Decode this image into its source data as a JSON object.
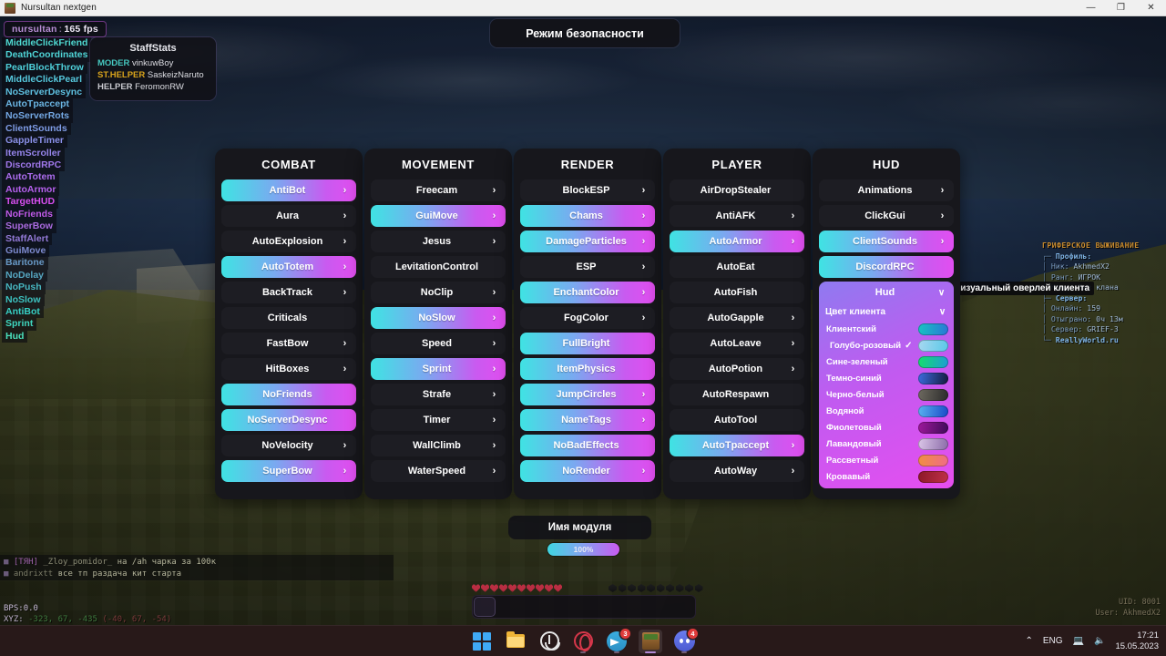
{
  "window": {
    "title": "Nursultan nextgen",
    "icon": "minecraft-block-icon",
    "minimize": "—",
    "maximize": "❐",
    "close": "✕"
  },
  "hud": {
    "watermark": {
      "name": "nursultan",
      "separator": ":",
      "fps": "165 fps"
    },
    "safe_mode_banner": "Режим безопасности",
    "module_name_popup": "Имя модуля",
    "module_progress": "100%",
    "tooltip": "Визуальный оверлей клиента",
    "uid": "UID: 8001",
    "user": "User: AkhmedX2",
    "active_modules": [
      {
        "label": "MiddleClickFriend",
        "color": "#4fd8d0"
      },
      {
        "label": "DeathCoordinates",
        "color": "#4fd4d6"
      },
      {
        "label": "PearlBlockThrow",
        "color": "#4fd0da"
      },
      {
        "label": "MiddleClickPearl",
        "color": "#56c8dd"
      },
      {
        "label": "NoServerDesync",
        "color": "#5ec0e0"
      },
      {
        "label": "AutoTpaccept",
        "color": "#6ab4e2"
      },
      {
        "label": "NoServerRots",
        "color": "#74a8e4"
      },
      {
        "label": "ClientSounds",
        "color": "#7f9ce6"
      },
      {
        "label": "GappleTimer",
        "color": "#8a90e8"
      },
      {
        "label": "ItemScroller",
        "color": "#9584ea"
      },
      {
        "label": "DiscordRPC",
        "color": "#a078eb"
      },
      {
        "label": "AutoTotem",
        "color": "#ab6ced"
      },
      {
        "label": "AutoArmor",
        "color": "#b660ee"
      },
      {
        "label": "TargetHUD",
        "color": "#d84ff0"
      },
      {
        "label": "NoFriends",
        "color": "#c05ae8"
      },
      {
        "label": "SuperBow",
        "color": "#a96ade"
      },
      {
        "label": "StaffAlert",
        "color": "#9279d6"
      },
      {
        "label": "GuiMove",
        "color": "#7c89ce"
      },
      {
        "label": "Baritone",
        "color": "#6899c6"
      },
      {
        "label": "NoDelay",
        "color": "#56a7c2"
      },
      {
        "label": "NoPush",
        "color": "#47b6c0"
      },
      {
        "label": "NoSlow",
        "color": "#3dc2c0"
      },
      {
        "label": "AntiBot",
        "color": "#37d0c4"
      },
      {
        "label": "Sprint",
        "color": "#3fd8c0"
      },
      {
        "label": "Hud",
        "color": "#4ae0bc"
      }
    ],
    "staff_stats": {
      "title": "StaffStats",
      "rows": [
        {
          "rank": "MODER",
          "rank_color": "#46c8c0",
          "nick": "vinkuwBoy"
        },
        {
          "rank": "ST.HELPER",
          "rank_color": "#d8a31c",
          "nick": "SaskeizNaruto"
        },
        {
          "rank": "HELPER",
          "rank_color": "#c9c9cf",
          "nick": "FeromonRW"
        }
      ]
    },
    "server_info": {
      "title": "ГРИФЕРСКОЕ ВЫЖИВАНИЕ",
      "lines": [
        {
          "prefix": "┌─",
          "key": "Профиль:",
          "value": "",
          "type": "section"
        },
        {
          "prefix": "│",
          "key": "Ник:",
          "value": "AkhmedX2",
          "type": "item"
        },
        {
          "prefix": "│",
          "key": "Ранг:",
          "value": "ИГРОК",
          "type": "item"
        },
        {
          "prefix": "│",
          "key": "Клан:",
          "value": "Без клана",
          "type": "item"
        },
        {
          "prefix": "├─",
          "key": "Сервер:",
          "value": "",
          "type": "section"
        },
        {
          "prefix": "│",
          "key": "Онлайн:",
          "value": "159",
          "type": "item"
        },
        {
          "prefix": "│",
          "key": "Отыграно:",
          "value": "0ч 13м",
          "type": "item"
        },
        {
          "prefix": "│",
          "key": "Сервер:",
          "value": "GRIEF-3",
          "type": "item"
        },
        {
          "prefix": "└─",
          "key": "ReallyWorld.ru",
          "value": "",
          "type": "footer"
        }
      ]
    },
    "chat": [
      {
        "badge": "■",
        "tag": "[ТЯН]",
        "nick": "_Zloy_pomidor_",
        "message": "на /ah чарка за 100к"
      },
      {
        "badge": "■",
        "tag": "",
        "nick": "andrixtt",
        "message": "все тп раздача кит старта"
      }
    ],
    "stats": {
      "bps_label": "BPS:",
      "bps_value": "0.0",
      "xyz_label": "XYZ:",
      "xyz_value": "-323, 67, -435",
      "xyz_chunk": "(-40, 67, -54)"
    }
  },
  "clickgui": {
    "panels": [
      {
        "title": "COMBAT",
        "modules": [
          {
            "label": "AntiBot",
            "enabled": true,
            "arrow": true
          },
          {
            "label": "Aura",
            "enabled": false,
            "arrow": true
          },
          {
            "label": "AutoExplosion",
            "enabled": false,
            "arrow": true
          },
          {
            "label": "AutoTotem",
            "enabled": true,
            "arrow": true
          },
          {
            "label": "BackTrack",
            "enabled": false,
            "arrow": true
          },
          {
            "label": "Criticals",
            "enabled": false,
            "arrow": false
          },
          {
            "label": "FastBow",
            "enabled": false,
            "arrow": true
          },
          {
            "label": "HitBoxes",
            "enabled": false,
            "arrow": true
          },
          {
            "label": "NoFriends",
            "enabled": true,
            "arrow": false
          },
          {
            "label": "NoServerDesync",
            "enabled": true,
            "arrow": false
          },
          {
            "label": "NoVelocity",
            "enabled": false,
            "arrow": true
          },
          {
            "label": "SuperBow",
            "enabled": true,
            "arrow": true
          }
        ]
      },
      {
        "title": "MOVEMENT",
        "modules": [
          {
            "label": "Freecam",
            "enabled": false,
            "arrow": true
          },
          {
            "label": "GuiMove",
            "enabled": true,
            "arrow": true
          },
          {
            "label": "Jesus",
            "enabled": false,
            "arrow": true
          },
          {
            "label": "LevitationControl",
            "enabled": false,
            "arrow": false
          },
          {
            "label": "NoClip",
            "enabled": false,
            "arrow": true
          },
          {
            "label": "NoSlow",
            "enabled": true,
            "arrow": true
          },
          {
            "label": "Speed",
            "enabled": false,
            "arrow": true
          },
          {
            "label": "Sprint",
            "enabled": true,
            "arrow": true
          },
          {
            "label": "Strafe",
            "enabled": false,
            "arrow": true
          },
          {
            "label": "Timer",
            "enabled": false,
            "arrow": true
          },
          {
            "label": "WallClimb",
            "enabled": false,
            "arrow": true
          },
          {
            "label": "WaterSpeed",
            "enabled": false,
            "arrow": true
          }
        ]
      },
      {
        "title": "RENDER",
        "modules": [
          {
            "label": "BlockESP",
            "enabled": false,
            "arrow": true
          },
          {
            "label": "Chams",
            "enabled": true,
            "arrow": true
          },
          {
            "label": "DamageParticles",
            "enabled": true,
            "arrow": true
          },
          {
            "label": "ESP",
            "enabled": false,
            "arrow": true
          },
          {
            "label": "EnchantColor",
            "enabled": true,
            "arrow": true
          },
          {
            "label": "FogColor",
            "enabled": false,
            "arrow": true
          },
          {
            "label": "FullBright",
            "enabled": true,
            "arrow": false
          },
          {
            "label": "ItemPhysics",
            "enabled": true,
            "arrow": false
          },
          {
            "label": "JumpCircles",
            "enabled": true,
            "arrow": true
          },
          {
            "label": "NameTags",
            "enabled": true,
            "arrow": true
          },
          {
            "label": "NoBadEffects",
            "enabled": true,
            "arrow": false
          },
          {
            "label": "NoRender",
            "enabled": true,
            "arrow": true
          }
        ]
      },
      {
        "title": "PLAYER",
        "modules": [
          {
            "label": "AirDropStealer",
            "enabled": false,
            "arrow": false
          },
          {
            "label": "AntiAFK",
            "enabled": false,
            "arrow": true
          },
          {
            "label": "AutoArmor",
            "enabled": true,
            "arrow": true
          },
          {
            "label": "AutoEat",
            "enabled": false,
            "arrow": false
          },
          {
            "label": "AutoFish",
            "enabled": false,
            "arrow": false
          },
          {
            "label": "AutoGapple",
            "enabled": false,
            "arrow": true
          },
          {
            "label": "AutoLeave",
            "enabled": false,
            "arrow": true
          },
          {
            "label": "AutoPotion",
            "enabled": false,
            "arrow": true
          },
          {
            "label": "AutoRespawn",
            "enabled": false,
            "arrow": false
          },
          {
            "label": "AutoTool",
            "enabled": false,
            "arrow": false
          },
          {
            "label": "AutoTpaccept",
            "enabled": true,
            "arrow": true
          },
          {
            "label": "AutoWay",
            "enabled": false,
            "arrow": true
          }
        ]
      },
      {
        "title": "HUD",
        "modules": [
          {
            "label": "Animations",
            "enabled": false,
            "arrow": true
          },
          {
            "label": "ClickGui",
            "enabled": false,
            "arrow": true
          },
          {
            "label": "ClientSounds",
            "enabled": true,
            "arrow": true
          },
          {
            "label": "DiscordRPC",
            "enabled": true,
            "arrow": false
          }
        ],
        "expanded_module": {
          "label": "Hud",
          "chevron": "∨",
          "setting": {
            "label": "Цвет клиента",
            "chevron": "∨"
          },
          "options": [
            {
              "label": "Клиентский",
              "selected": false,
              "swatch_from": "#17c6c0",
              "swatch_to": "#2a74d8"
            },
            {
              "label": "Голубо-розовый",
              "selected": true,
              "swatch_from": "#a8d8f0",
              "swatch_to": "#59c8e8"
            },
            {
              "label": "Сине-зеленый",
              "selected": false,
              "swatch_from": "#13e06a",
              "swatch_to": "#1f9ad8"
            },
            {
              "label": "Темно-синий",
              "selected": false,
              "swatch_from": "#3b6ce0",
              "swatch_to": "#141a3c"
            },
            {
              "label": "Черно-белый",
              "selected": false,
              "swatch_from": "#6e6a60",
              "swatch_to": "#2a2a2a"
            },
            {
              "label": "Водяной",
              "selected": false,
              "swatch_from": "#59b4f0",
              "swatch_to": "#1a48c8"
            },
            {
              "label": "Фиолетовый",
              "selected": false,
              "swatch_from": "#a0189c",
              "swatch_to": "#3c0c58"
            },
            {
              "label": "Лавандовый",
              "selected": false,
              "swatch_from": "#dcc8e8",
              "swatch_to": "#8a6aa8"
            },
            {
              "label": "Рассветный",
              "selected": false,
              "swatch_from": "#f09040",
              "swatch_to": "#f06a8a"
            },
            {
              "label": "Кровавый",
              "selected": false,
              "swatch_from": "#8c1828",
              "swatch_to": "#c03048"
            }
          ],
          "check_glyph": "✓"
        }
      }
    ],
    "chevron_right": "›"
  },
  "taskbar": {
    "items": [
      {
        "name": "start",
        "icon": "windows-logo-icon",
        "badge": "",
        "running": false
      },
      {
        "name": "explorer",
        "icon": "folder-icon",
        "badge": "",
        "running": false
      },
      {
        "name": "cortana",
        "icon": "cortana-icon",
        "badge": "",
        "running": false
      },
      {
        "name": "opera",
        "icon": "opera-icon",
        "badge": "",
        "running": true
      },
      {
        "name": "telegram",
        "icon": "telegram-icon",
        "badge": "3",
        "running": true
      },
      {
        "name": "minecraft",
        "icon": "minecraft-icon",
        "badge": "",
        "running": true
      },
      {
        "name": "discord",
        "icon": "discord-icon",
        "badge": "4",
        "running": true
      }
    ],
    "tray": {
      "chevron": "⌃",
      "language": "ENG",
      "network_icon": "network-icon",
      "volume_icon": "volume-icon",
      "time": "17:21",
      "date": "15.05.2023"
    }
  }
}
